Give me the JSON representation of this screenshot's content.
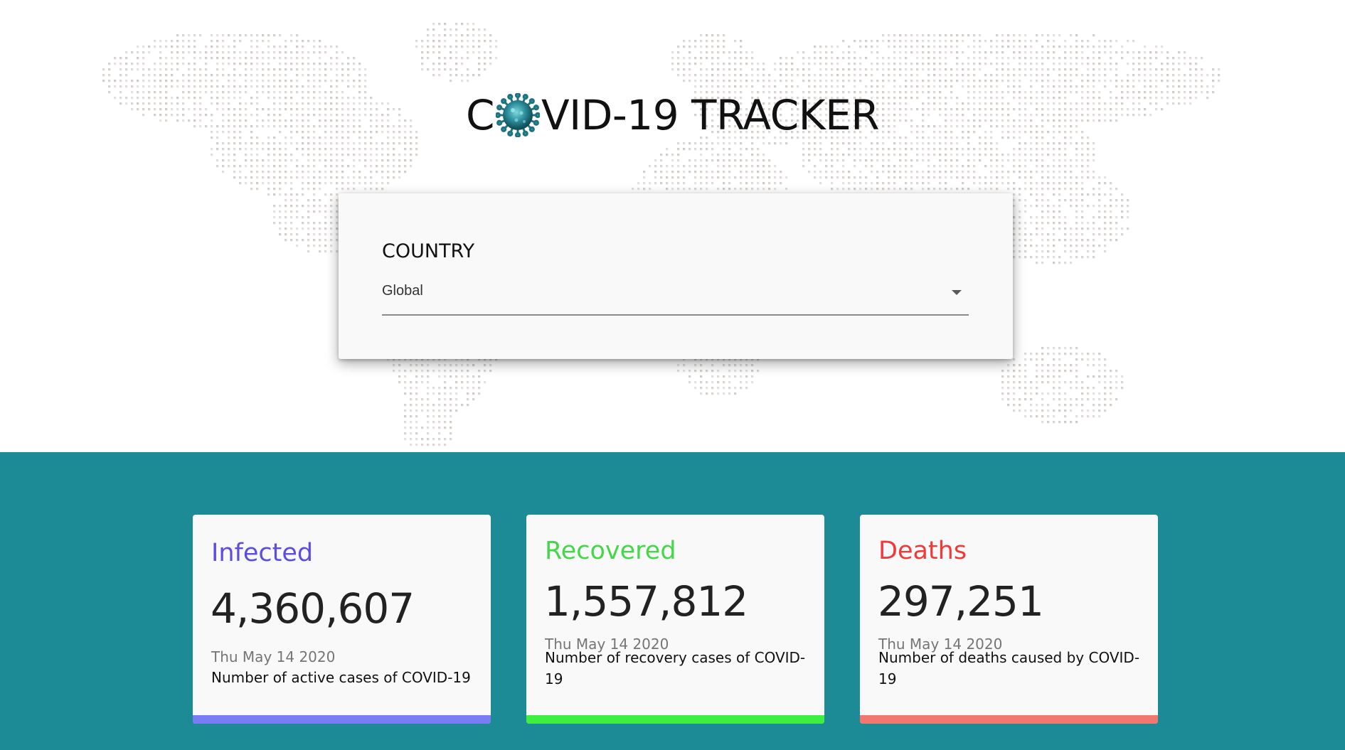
{
  "header": {
    "title_prefix": "C",
    "title_suffix": "VID-19 TRACKER",
    "logo_icon": "coronavirus-icon"
  },
  "picker": {
    "label": "COUNTRY",
    "selected": "Global"
  },
  "cards": [
    {
      "title": "Infected",
      "value": "4,360,607",
      "date": "Thu May 14 2020",
      "description": "Number of active cases of COVID-19",
      "color": "#5b4de0",
      "bar_color": "#7a7cf5"
    },
    {
      "title": "Recovered",
      "value": "1,557,812",
      "date": "Thu May 14 2020",
      "description": "Number of recovery cases of COVID-19",
      "color": "#45d74a",
      "bar_color": "#3fef3f"
    },
    {
      "title": "Deaths",
      "value": "297,251",
      "date": "Thu May 14 2020",
      "description": "Number of deaths caused by COVID-19",
      "color": "#f03a3a",
      "bar_color": "#f2776f"
    }
  ],
  "theme": {
    "band_color": "#1c8b95",
    "map_dot_color": "#cfc8c3"
  }
}
